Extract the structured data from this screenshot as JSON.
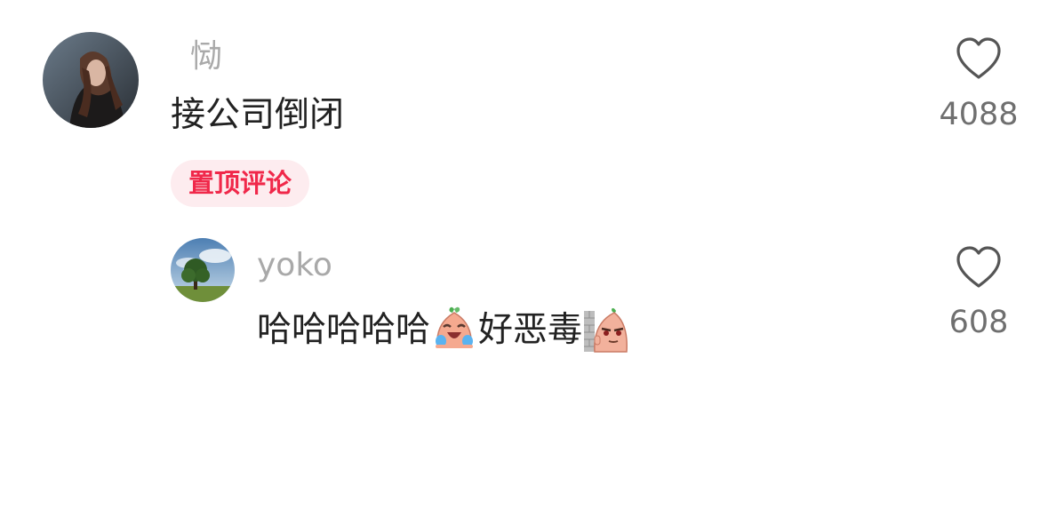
{
  "comment": {
    "username": "恸",
    "text": "接公司倒闭",
    "badge": "置顶评论",
    "likes": "4088"
  },
  "reply": {
    "username": "yoko",
    "text_part1": "哈哈哈哈哈",
    "emoji1": "crying-laughing-emoji",
    "text_part2": "好恶毒",
    "emoji2": "peeking-behind-wall-emoji",
    "likes": "608"
  },
  "icons": {
    "like": "heart-outline-icon"
  },
  "colors": {
    "username": "#a9a9a9",
    "text": "#222222",
    "badge_text": "#f0284a",
    "badge_bg": "#fdecef",
    "count": "#6f6f6f",
    "heart_stroke": "#555555"
  }
}
